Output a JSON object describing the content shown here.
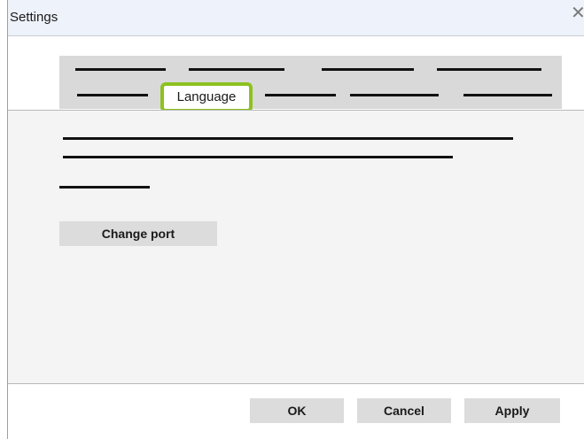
{
  "window": {
    "title": "Settings"
  },
  "tabs": {
    "active_label": "Language"
  },
  "content": {
    "change_port_label": "Change port"
  },
  "footer": {
    "ok_label": "OK",
    "cancel_label": "Cancel",
    "apply_label": "Apply"
  },
  "colors": {
    "highlight": "#8cc21f",
    "button_bg": "#dcdcdc",
    "panel_bg": "#f4f4f4",
    "titlebar_bg": "#eef2fa"
  },
  "icons": {
    "close": "close-icon"
  }
}
